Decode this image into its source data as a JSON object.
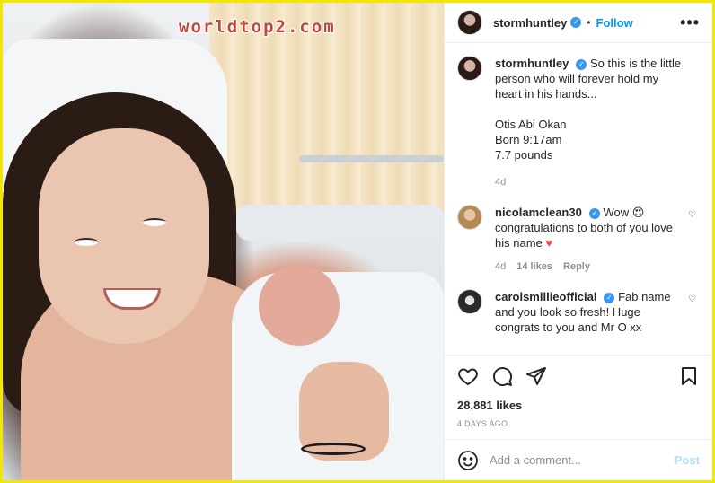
{
  "watermark": "worldtop2.com",
  "header": {
    "username": "stormhuntley",
    "dot": "•",
    "follow_label": "Follow",
    "more_label": "•••"
  },
  "caption": {
    "username": "stormhuntley",
    "text_line1": "So this is the little person who will forever hold my heart in his hands...",
    "text_line2": "Otis Abi Okan",
    "text_line3": "Born 9:17am",
    "text_line4": "7.7 pounds",
    "age": "4d"
  },
  "comments": [
    {
      "username": "nicolamclean30",
      "text": "Wow 😍 congratulations to both of you love his name",
      "emoji_heart": "♥",
      "age": "4d",
      "likes": "14 likes",
      "reply_label": "Reply"
    },
    {
      "username": "carolsmillieofficial",
      "text": "Fab name and you look so fresh! Huge congrats to you and Mr O xx"
    }
  ],
  "actions": {
    "likes": "28,881 likes",
    "timestamp": "4 DAYS AGO"
  },
  "comment_box": {
    "placeholder": "Add a comment...",
    "post_label": "Post"
  },
  "colors": {
    "accent": "#0095f6",
    "verified": "#3897f0",
    "heart": "#ed4956",
    "border": "#f3e600"
  }
}
